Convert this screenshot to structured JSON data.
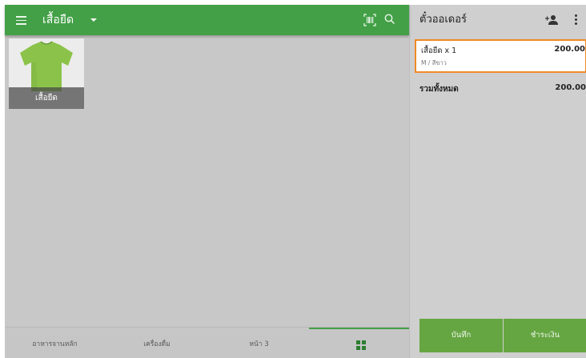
{
  "header": {
    "category_title": "เสื้อยืด",
    "icons": {
      "menu": "menu-icon",
      "dropdown": "caret-down-icon",
      "barcode": "barcode-scan-icon",
      "search": "search-icon"
    }
  },
  "products": [
    {
      "label": "เสื้อยืด",
      "image": "green-tshirt"
    }
  ],
  "bottom_tabs": [
    {
      "label": "อาหารจานหลัก"
    },
    {
      "label": "เครื่องดื่ม"
    },
    {
      "label": "หน้า 3"
    },
    {
      "label": "",
      "icon": "grid-icon",
      "active": true
    }
  ],
  "order": {
    "title": "ตั๋วออเดอร์",
    "icons": {
      "add_customer": "add-person-icon",
      "more": "more-vertical-icon"
    },
    "items": [
      {
        "name": "เสื้อยืด x 1",
        "variant": "M / สีขาว",
        "price": "200.00"
      }
    ],
    "total_label": "รวมทั้งหมด",
    "total_value": "200.00",
    "save_label": "บันทึก",
    "pay_label": "ชำระเงิน"
  },
  "colors": {
    "primary_green": "#43a047",
    "button_green": "#66a642",
    "highlight_orange": "#f08a24"
  }
}
